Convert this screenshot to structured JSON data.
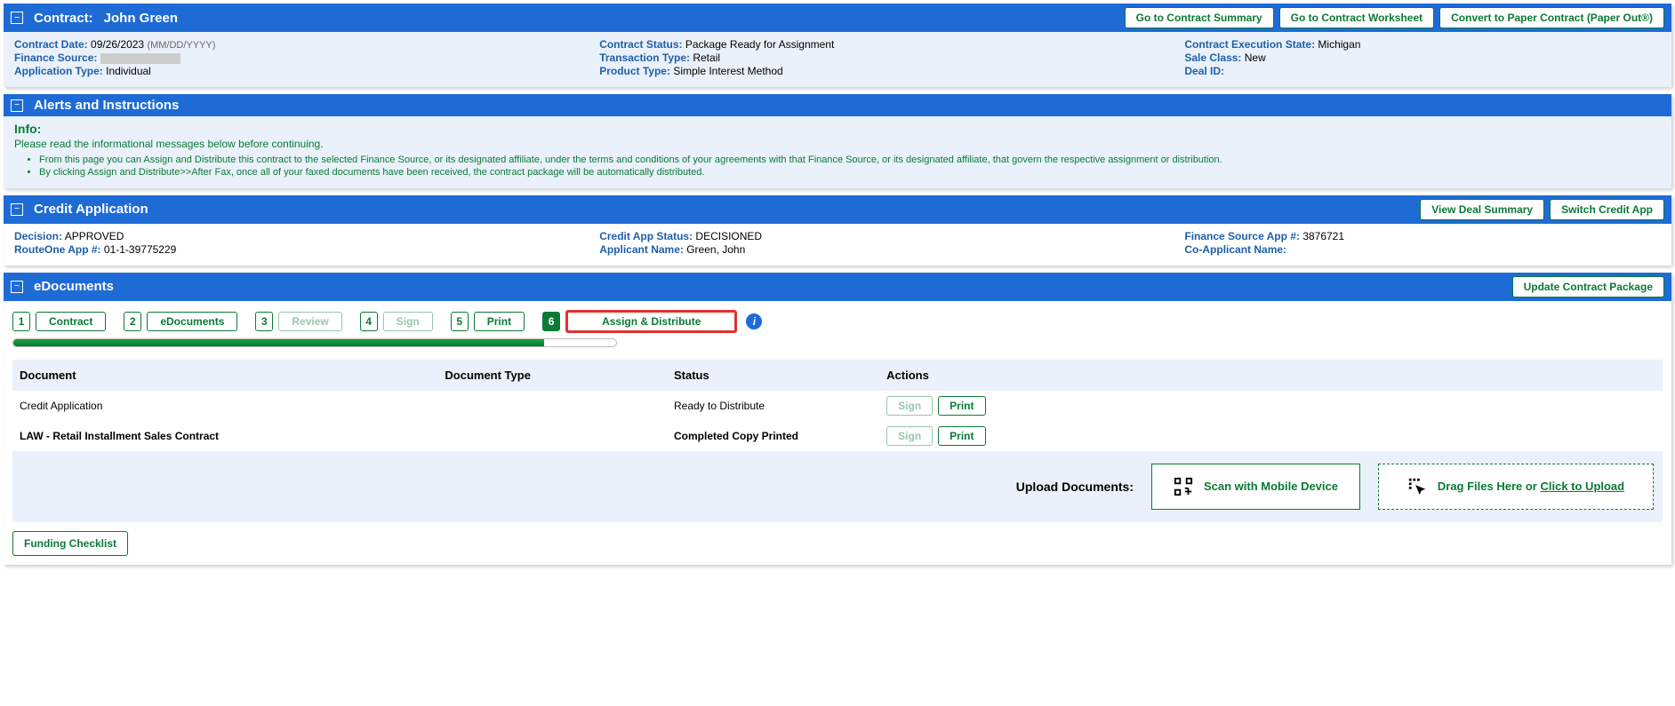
{
  "contract": {
    "title_prefix": "Contract:",
    "title_name": "John Green",
    "buttons": {
      "summary": "Go to Contract Summary",
      "worksheet": "Go to Contract Worksheet",
      "paper": "Convert to Paper Contract (Paper Out®)"
    },
    "fields": {
      "contract_date_lbl": "Contract Date:",
      "contract_date_val": "09/26/2023",
      "contract_date_hint": "(MM/DD/YYYY)",
      "finance_source_lbl": "Finance Source:",
      "application_type_lbl": "Application Type:",
      "application_type_val": "Individual",
      "contract_status_lbl": "Contract Status:",
      "contract_status_val": "Package Ready for Assignment",
      "transaction_type_lbl": "Transaction Type:",
      "transaction_type_val": "Retail",
      "product_type_lbl": "Product Type:",
      "product_type_val": "Simple Interest Method",
      "exec_state_lbl": "Contract Execution State:",
      "exec_state_val": "Michigan",
      "sale_class_lbl": "Sale Class:",
      "sale_class_val": "New",
      "deal_id_lbl": "Deal ID:",
      "deal_id_val": ""
    }
  },
  "alerts": {
    "title": "Alerts and Instructions",
    "heading": "Info:",
    "intro": "Please read the informational messages below before continuing.",
    "items": [
      "From this page you can Assign and Distribute this contract to the selected Finance Source, or its designated affiliate, under the terms and conditions of your agreements with that Finance Source, or its designated affiliate, that govern the respective assignment or distribution.",
      "By clicking Assign and Distribute>>After Fax, once all of your faxed documents have been received, the contract package will be automatically distributed."
    ]
  },
  "credit": {
    "title": "Credit Application",
    "buttons": {
      "view_deal": "View Deal Summary",
      "switch": "Switch Credit App"
    },
    "fields": {
      "decision_lbl": "Decision:",
      "decision_val": "APPROVED",
      "r1app_lbl": "RouteOne App #:",
      "r1app_val": "01-1-39775229",
      "status_lbl": "Credit App Status:",
      "status_val": "DECISIONED",
      "applicant_lbl": "Applicant Name:",
      "applicant_val": "Green, John",
      "fsapp_lbl": "Finance Source App #:",
      "fsapp_val": "3876721",
      "coapp_lbl": "Co-Applicant Name:",
      "coapp_val": ""
    }
  },
  "edoc": {
    "title": "eDocuments",
    "update_btn": "Update Contract Package",
    "steps": {
      "n1": "1",
      "s1": "Contract",
      "n2": "2",
      "s2": "eDocuments",
      "n3": "3",
      "s3": "Review",
      "n4": "4",
      "s4": "Sign",
      "n5": "5",
      "s5": "Print",
      "n6": "6",
      "s6": "Assign & Distribute"
    },
    "table": {
      "h_doc": "Document",
      "h_type": "Document Type",
      "h_status": "Status",
      "h_actions": "Actions",
      "rows": [
        {
          "doc": "Credit Application",
          "type": "",
          "status": "Ready to Distribute"
        },
        {
          "doc": "LAW - Retail Installment Sales Contract",
          "type": "",
          "status": "Completed Copy Printed"
        }
      ],
      "sign_btn": "Sign",
      "print_btn": "Print"
    },
    "upload": {
      "label": "Upload Documents:",
      "scan": "Scan with Mobile Device",
      "drag_prefix": "Drag Files Here or ",
      "drag_link": "Click to Upload"
    },
    "funding_btn": "Funding Checklist"
  }
}
